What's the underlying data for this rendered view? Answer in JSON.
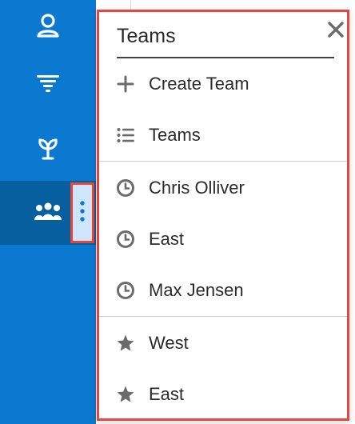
{
  "sidebar": {
    "items": [
      {
        "icon": "user-icon"
      },
      {
        "icon": "filter-icon"
      },
      {
        "icon": "sprout-icon"
      },
      {
        "icon": "team-icon"
      }
    ],
    "more_icon": "vertical-ellipsis-icon"
  },
  "dropdown": {
    "title": "Teams",
    "close_icon": "close-icon",
    "actions": [
      {
        "label": "Create Team",
        "icon": "plus-icon"
      },
      {
        "label": "Teams",
        "icon": "list-icon"
      }
    ],
    "recent": [
      {
        "label": "Chris Olliver",
        "icon": "clock-icon"
      },
      {
        "label": "East",
        "icon": "clock-icon"
      },
      {
        "label": "Max Jensen",
        "icon": "clock-icon"
      }
    ],
    "favorites": [
      {
        "label": "West",
        "icon": "star-icon"
      },
      {
        "label": "East",
        "icon": "star-icon"
      }
    ]
  },
  "colors": {
    "sidebar": "#0b79d0",
    "sidebar_active": "#075f9f",
    "highlight": "#e4483c"
  }
}
